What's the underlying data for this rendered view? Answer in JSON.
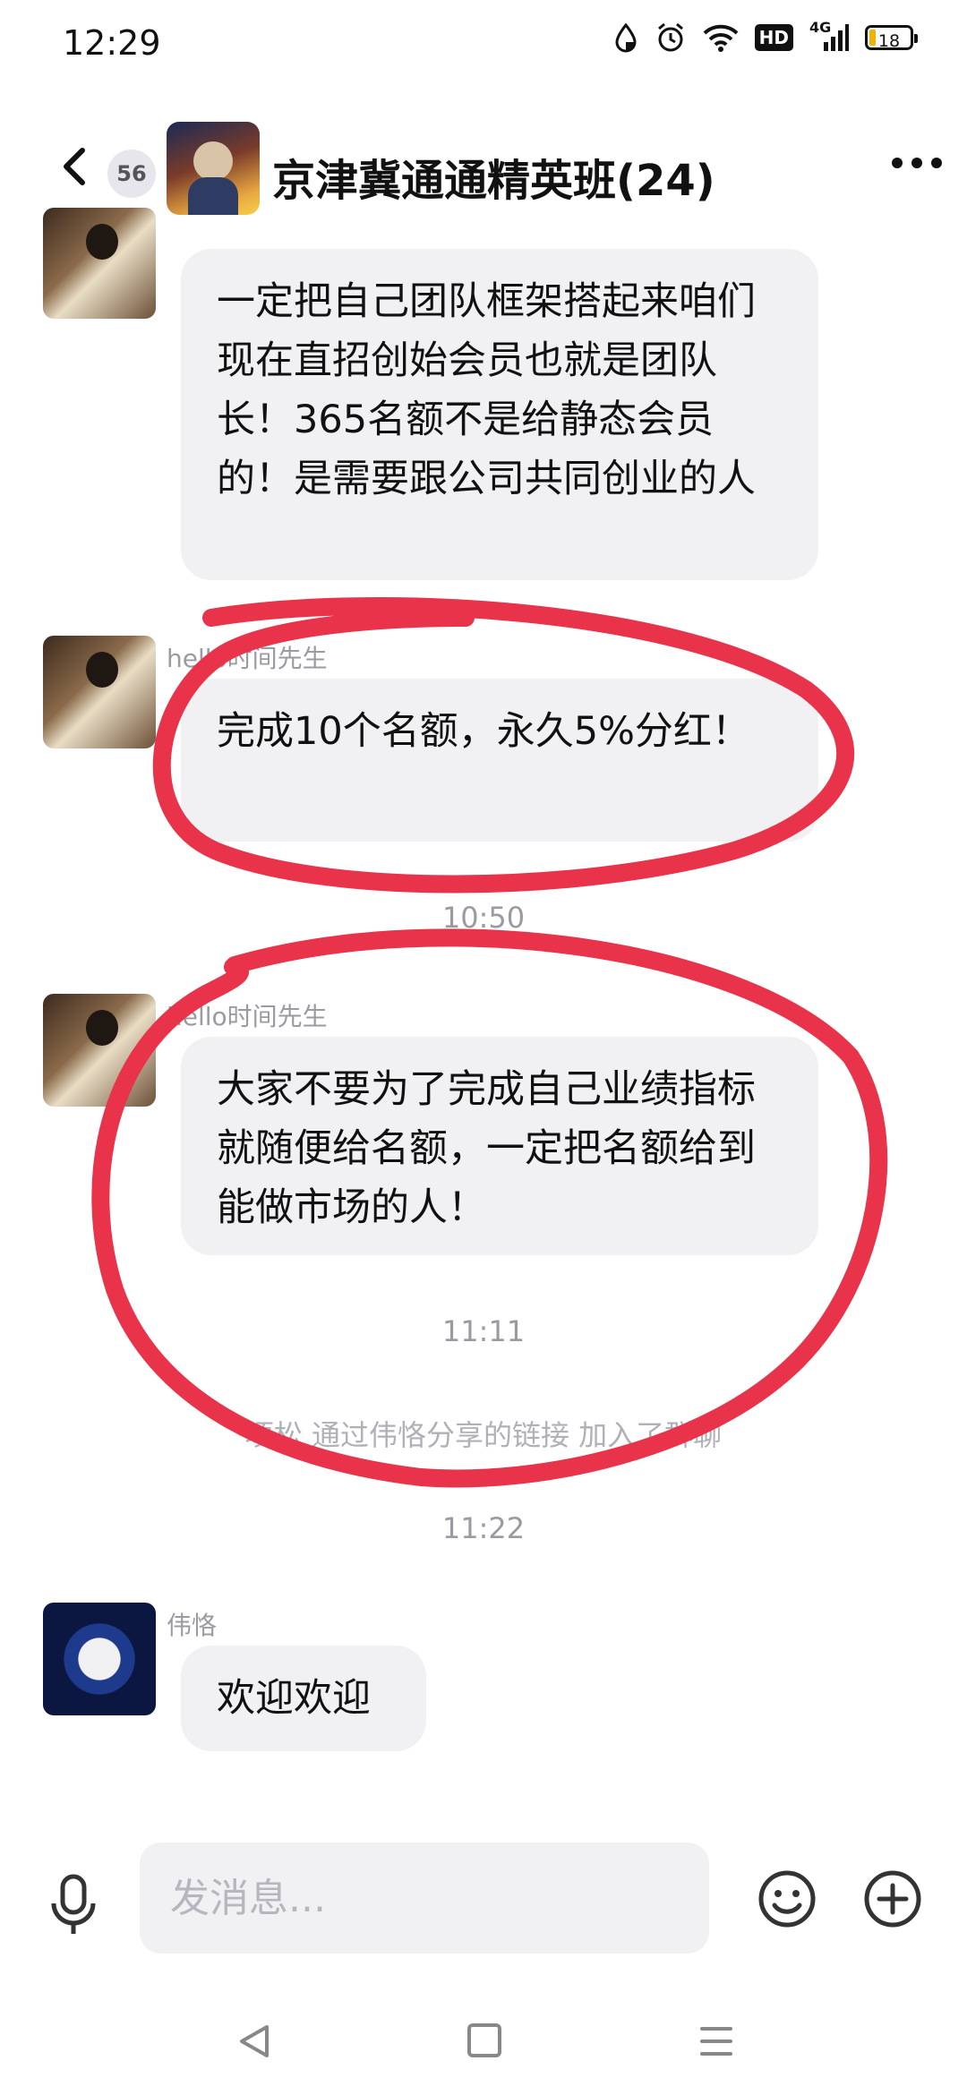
{
  "status_bar": {
    "time": "12:29",
    "network": "4G",
    "hd_label": "HD",
    "battery": "18"
  },
  "header": {
    "unread_count": "56",
    "title": "京津冀通通精英班(24)"
  },
  "messages": [
    {
      "sender": "",
      "text": "一定把自己团队框架搭起来咱们现在直招创始会员也就是团队长！365名额不是给静态会员的！是需要跟公司共同创业的人"
    },
    {
      "sender": "hello时间先生",
      "text": "完成10个名额，永久5%分红！"
    },
    {
      "time": "10:50"
    },
    {
      "sender": "hello时间先生",
      "text": "大家不要为了完成自己业绩指标就随便给名额，一定把名额给到能做市场的人！"
    },
    {
      "time": "11:11"
    },
    {
      "system": "项松 通过伟恪分享的链接 加入了群聊"
    },
    {
      "time": "11:22"
    },
    {
      "sender": "伟恪",
      "text": "欢迎欢迎"
    }
  ],
  "input": {
    "placeholder": "发消息..."
  },
  "colors": {
    "bubble": "#f1f1f4",
    "annotation_red": "#e8334a",
    "muted_text": "#9a9aa3"
  },
  "icons": [
    "back-icon",
    "more-icon",
    "mic-icon",
    "emoji-icon",
    "plus-icon",
    "nav-back-icon",
    "nav-home-icon",
    "nav-menu-icon"
  ]
}
